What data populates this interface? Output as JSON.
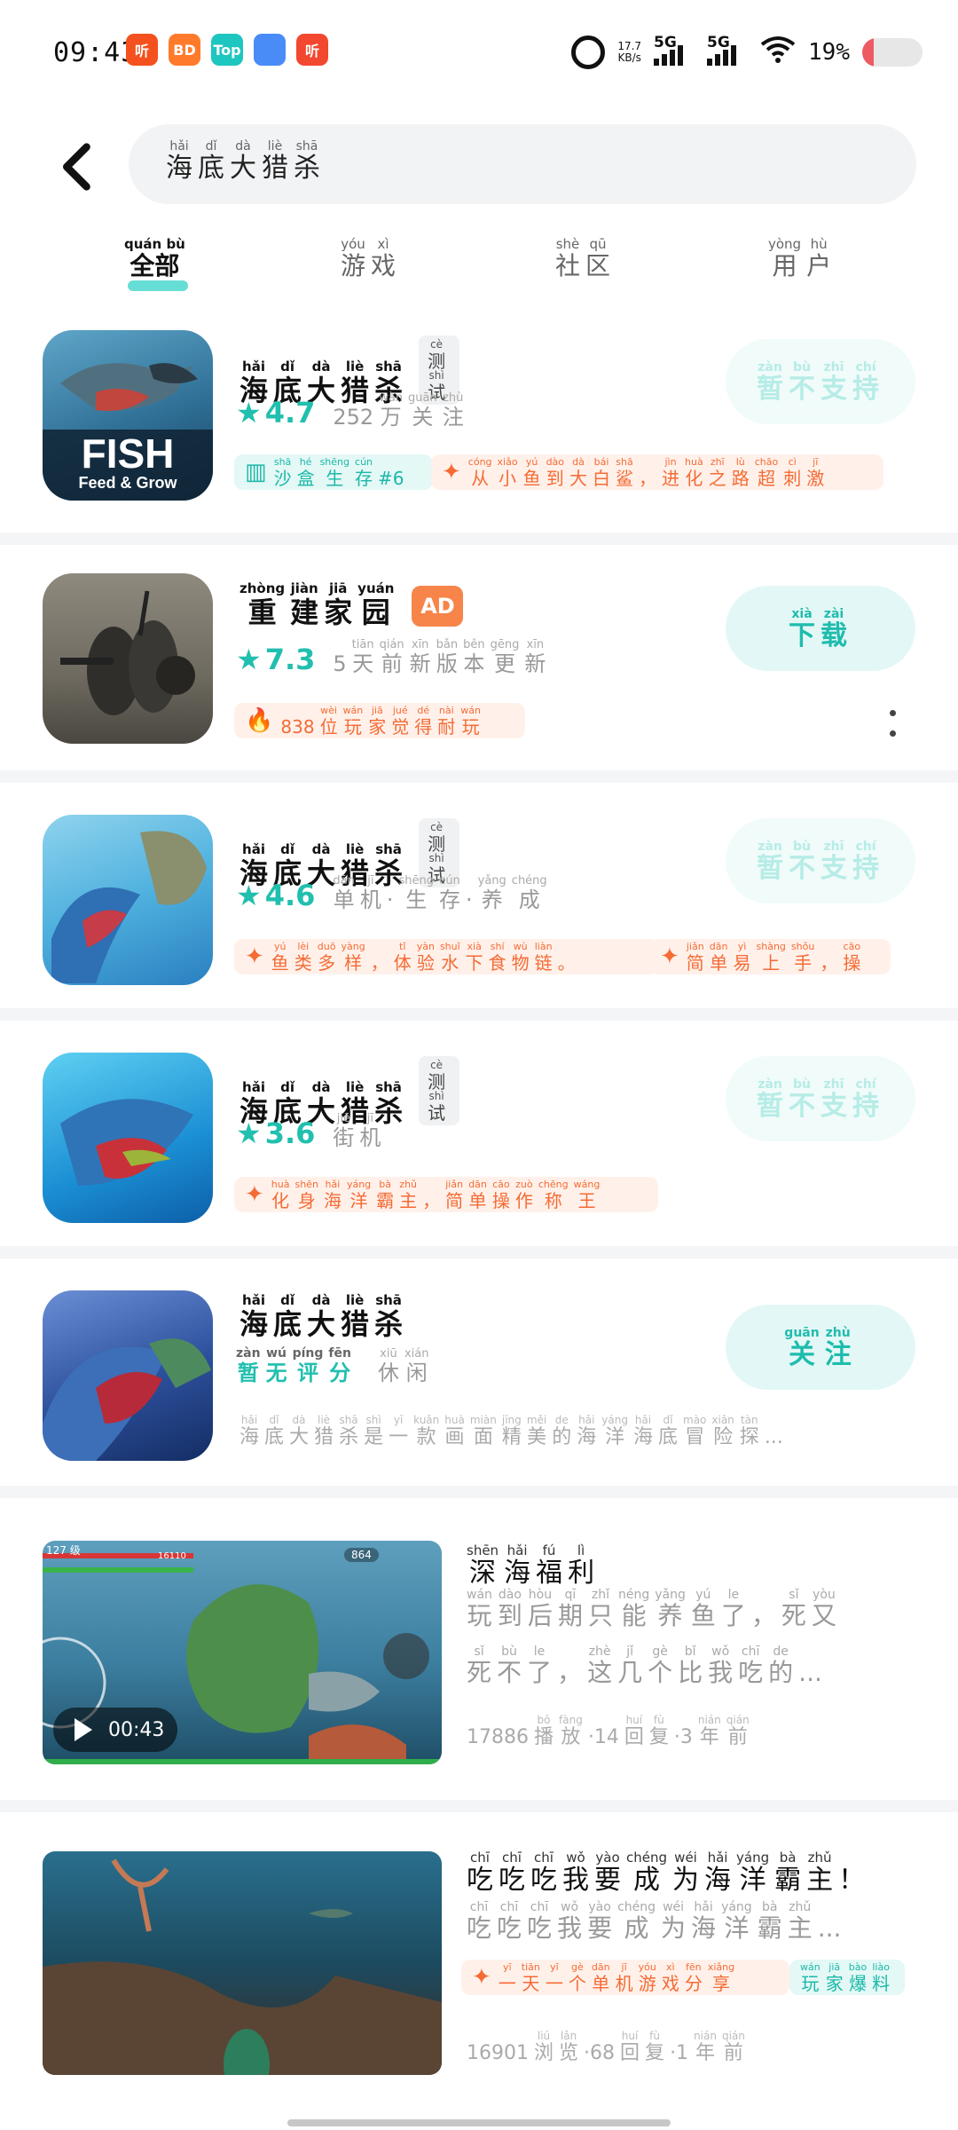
{
  "status_bar": {
    "time": "09:43",
    "app_icons": [
      {
        "name": "ting-app-icon",
        "text": "听",
        "color": "#f4511e"
      },
      {
        "name": "shop-app-icon",
        "text": "BD",
        "color": "#ff7a2b"
      },
      {
        "name": "top-app-icon",
        "text": "Top",
        "color": "#1ec6c0"
      },
      {
        "name": "blue-app-icon",
        "text": "",
        "color": "#4a8cf7"
      },
      {
        "name": "ting2-app-icon",
        "text": "听",
        "color": "#f2482f"
      }
    ],
    "net_speed": "17.7",
    "net_unit": "KB/s",
    "sig1_label": "5G",
    "sig2_label": "5G",
    "battery_pct": "19%",
    "battery_level": 0.19,
    "battery_color": "#ee5a63"
  },
  "search": {
    "query": [
      [
        "海",
        "hǎi"
      ],
      [
        "底",
        "dǐ"
      ],
      [
        "大",
        "dà"
      ],
      [
        "猎",
        "liè"
      ],
      [
        "杀",
        "shā"
      ]
    ]
  },
  "tabs": [
    {
      "label": [
        [
          "全部",
          "quán bù"
        ]
      ],
      "active": true
    },
    {
      "label": [
        [
          "游",
          "yóu"
        ],
        [
          "戏",
          "xì"
        ]
      ],
      "active": false
    },
    {
      "label": [
        [
          "社",
          "shè"
        ],
        [
          "区",
          "qū"
        ]
      ],
      "active": false
    },
    {
      "label": [
        [
          "用",
          "yòng"
        ],
        [
          "户",
          "hù"
        ]
      ],
      "active": false
    }
  ],
  "games": [
    {
      "title": [
        [
          "海",
          "hǎi"
        ],
        [
          "底",
          "dǐ"
        ],
        [
          "大",
          "dà"
        ],
        [
          "猎",
          "liè"
        ],
        [
          "杀",
          "shā"
        ]
      ],
      "badge_test": [
        [
          "测",
          "cè"
        ],
        [
          "试",
          "shì"
        ]
      ],
      "rating": "4.7",
      "meta": [
        [
          "252",
          ""
        ],
        [
          "万",
          "wàn"
        ],
        [
          "关",
          "guān"
        ],
        [
          "注",
          "zhù"
        ]
      ],
      "chip1_icon": "trophy-icon",
      "chip1": [
        [
          "沙",
          "shā"
        ],
        [
          "盒",
          "hé"
        ],
        [
          "生",
          "shēng"
        ],
        [
          "存",
          "cún"
        ],
        [
          "#6",
          ""
        ]
      ],
      "chip2": [
        [
          "从",
          "cóng"
        ],
        [
          "小",
          "xiǎo"
        ],
        [
          "鱼",
          "yú"
        ],
        [
          "到",
          "dào"
        ],
        [
          "大",
          "dà"
        ],
        [
          "白",
          "bái"
        ],
        [
          "鲨",
          "shā"
        ],
        [
          "，",
          ""
        ],
        [
          "进",
          "jìn"
        ],
        [
          "化",
          "huà"
        ],
        [
          "之",
          "zhī"
        ],
        [
          "路",
          "lù"
        ],
        [
          "超",
          "chāo"
        ],
        [
          "刺",
          "cì"
        ],
        [
          "激",
          "jī"
        ]
      ],
      "button": [
        [
          "暂",
          "zàn"
        ],
        [
          "不",
          "bù"
        ],
        [
          "支",
          "zhī"
        ],
        [
          "持",
          "chí"
        ]
      ],
      "button_state": "disabled",
      "thumb_text": "FISH",
      "thumb_sub": "Feed & Grow"
    },
    {
      "title": [
        [
          "重",
          "zhòng"
        ],
        [
          "建",
          "jiàn"
        ],
        [
          "家",
          "jiā"
        ],
        [
          "园",
          "yuán"
        ]
      ],
      "badge_ad": "AD",
      "rating": "7.3",
      "meta": [
        [
          "5",
          ""
        ],
        [
          "天",
          "tiān"
        ],
        [
          "前",
          "qián"
        ],
        [
          "新",
          "xīn"
        ],
        [
          "版",
          "bǎn"
        ],
        [
          "本",
          "běn"
        ],
        [
          "更",
          "gēng"
        ],
        [
          "新",
          "xīn"
        ]
      ],
      "chip_hot": [
        [
          "838",
          ""
        ],
        [
          "位",
          "wèi"
        ],
        [
          "玩",
          "wán"
        ],
        [
          "家",
          "jiā"
        ],
        [
          "觉",
          "jué"
        ],
        [
          "得",
          "dé"
        ],
        [
          "耐",
          "nài"
        ],
        [
          "玩",
          "wán"
        ]
      ],
      "button": [
        [
          "下",
          "xià"
        ],
        [
          "载",
          "zài"
        ]
      ],
      "button_state": "primary"
    },
    {
      "title": [
        [
          "海",
          "hǎi"
        ],
        [
          "底",
          "dǐ"
        ],
        [
          "大",
          "dà"
        ],
        [
          "猎",
          "liè"
        ],
        [
          "杀",
          "shā"
        ]
      ],
      "badge_test": [
        [
          "测",
          "cè"
        ],
        [
          "试",
          "shì"
        ]
      ],
      "rating": "4.6",
      "meta": [
        [
          "单",
          "dān"
        ],
        [
          "机",
          "jī"
        ],
        [
          "·",
          ""
        ],
        [
          "生",
          "shēng"
        ],
        [
          "存",
          "cún"
        ],
        [
          "·",
          ""
        ],
        [
          "养",
          "yǎng"
        ],
        [
          "成",
          "chéng"
        ]
      ],
      "chip1": [
        [
          "鱼",
          "yú"
        ],
        [
          "类",
          "lèi"
        ],
        [
          "多",
          "duō"
        ],
        [
          "样",
          "yàng"
        ],
        [
          "，",
          ""
        ],
        [
          "体",
          "tǐ"
        ],
        [
          "验",
          "yàn"
        ],
        [
          "水",
          "shuǐ"
        ],
        [
          "下",
          "xià"
        ],
        [
          "食",
          "shí"
        ],
        [
          "物",
          "wù"
        ],
        [
          "链",
          "liàn"
        ],
        [
          "。",
          ""
        ]
      ],
      "chip2": [
        [
          "简",
          "jiǎn"
        ],
        [
          "单",
          "dān"
        ],
        [
          "易",
          "yì"
        ],
        [
          "上",
          "shàng"
        ],
        [
          "手",
          "shǒu"
        ],
        [
          "，",
          ""
        ],
        [
          "操",
          "cāo"
        ]
      ],
      "button": [
        [
          "暂",
          "zàn"
        ],
        [
          "不",
          "bù"
        ],
        [
          "支",
          "zhī"
        ],
        [
          "持",
          "chí"
        ]
      ],
      "button_state": "disabled"
    },
    {
      "title": [
        [
          "海",
          "hǎi"
        ],
        [
          "底",
          "dǐ"
        ],
        [
          "大",
          "dà"
        ],
        [
          "猎",
          "liè"
        ],
        [
          "杀",
          "shā"
        ]
      ],
      "badge_test": [
        [
          "测",
          "cè"
        ],
        [
          "试",
          "shì"
        ]
      ],
      "rating": "3.6",
      "meta": [
        [
          "街",
          "jiē"
        ],
        [
          "机",
          "jī"
        ]
      ],
      "chip1": [
        [
          "化",
          "huà"
        ],
        [
          "身",
          "shēn"
        ],
        [
          "海",
          "hǎi"
        ],
        [
          "洋",
          "yáng"
        ],
        [
          "霸",
          "bà"
        ],
        [
          "主",
          "zhǔ"
        ],
        [
          "，",
          ""
        ],
        [
          "简",
          "jiǎn"
        ],
        [
          "单",
          "dān"
        ],
        [
          "操",
          "cāo"
        ],
        [
          "作",
          "zuò"
        ],
        [
          "称",
          "chēng"
        ],
        [
          "王",
          "wáng"
        ]
      ],
      "button": [
        [
          "暂",
          "zàn"
        ],
        [
          "不",
          "bù"
        ],
        [
          "支",
          "zhī"
        ],
        [
          "持",
          "chí"
        ]
      ],
      "button_state": "disabled"
    },
    {
      "title": [
        [
          "海",
          "hǎi"
        ],
        [
          "底",
          "dǐ"
        ],
        [
          "大",
          "dà"
        ],
        [
          "猎",
          "liè"
        ],
        [
          "杀",
          "shā"
        ]
      ],
      "no_rating": [
        [
          "暂",
          "zàn"
        ],
        [
          "无",
          "wú"
        ],
        [
          "评",
          "píng"
        ],
        [
          "分",
          "fēn"
        ]
      ],
      "meta": [
        [
          "休",
          "xiū"
        ],
        [
          "闲",
          "xián"
        ]
      ],
      "desc": [
        [
          "海",
          "hǎi"
        ],
        [
          "底",
          "dǐ"
        ],
        [
          "大",
          "dà"
        ],
        [
          "猎",
          "liè"
        ],
        [
          "杀",
          "shā"
        ],
        [
          "是",
          "shì"
        ],
        [
          "一",
          "yī"
        ],
        [
          "款",
          "kuǎn"
        ],
        [
          "画",
          "huà"
        ],
        [
          "面",
          "miàn"
        ],
        [
          "精",
          "jīng"
        ],
        [
          "美",
          "měi"
        ],
        [
          "的",
          "de"
        ],
        [
          "海",
          "hǎi"
        ],
        [
          "洋",
          "yáng"
        ],
        [
          "海",
          "hǎi"
        ],
        [
          "底",
          "dǐ"
        ],
        [
          "冒",
          "mào"
        ],
        [
          "险",
          "xiǎn"
        ],
        [
          "探",
          "tàn"
        ],
        [
          "...",
          ""
        ]
      ],
      "button": [
        [
          "关",
          "guān"
        ],
        [
          "注",
          "zhù"
        ]
      ],
      "button_state": "primary"
    }
  ],
  "posts": [
    {
      "title": [
        [
          "深",
          "shēn"
        ],
        [
          "海",
          "hǎi"
        ],
        [
          "福",
          "fú"
        ],
        [
          "利",
          "lì"
        ]
      ],
      "body1": [
        [
          "玩",
          "wán"
        ],
        [
          "到",
          "dào"
        ],
        [
          "后",
          "hòu"
        ],
        [
          "期",
          "qī"
        ],
        [
          "只",
          "zhǐ"
        ],
        [
          "能",
          "néng"
        ],
        [
          "养",
          "yǎng"
        ],
        [
          "鱼",
          "yú"
        ],
        [
          "了",
          "le"
        ],
        [
          "，",
          ""
        ],
        [
          "死",
          "sǐ"
        ],
        [
          "又",
          "yòu"
        ]
      ],
      "body2": [
        [
          "死",
          "sǐ"
        ],
        [
          "不",
          "bù"
        ],
        [
          "了",
          "le"
        ],
        [
          "，",
          ""
        ],
        [
          "这",
          "zhè"
        ],
        [
          "几",
          "jǐ"
        ],
        [
          "个",
          "gè"
        ],
        [
          "比",
          "bǐ"
        ],
        [
          "我",
          "wǒ"
        ],
        [
          "吃",
          "chī"
        ],
        [
          "的",
          "de"
        ],
        [
          "...",
          ""
        ]
      ],
      "meta": [
        [
          "17886",
          ""
        ],
        [
          "播",
          "bō"
        ],
        [
          "放",
          "fàng"
        ],
        [
          "·14",
          ""
        ],
        [
          "回",
          "huí"
        ],
        [
          "复",
          "fù"
        ],
        [
          "·3",
          ""
        ],
        [
          "年",
          "nián"
        ],
        [
          "前",
          "qián"
        ]
      ],
      "duration": "00:43",
      "level_label": "127 级",
      "hp": "16110",
      "coins": "864"
    },
    {
      "title": [
        [
          "吃",
          "chī"
        ],
        [
          "吃",
          "chī"
        ],
        [
          "吃",
          "chī"
        ],
        [
          "我",
          "wǒ"
        ],
        [
          "要",
          "yào"
        ],
        [
          "成",
          "chéng"
        ],
        [
          "为",
          "wéi"
        ],
        [
          "海",
          "hǎi"
        ],
        [
          "洋",
          "yáng"
        ],
        [
          "霸",
          "bà"
        ],
        [
          "主",
          "zhǔ"
        ],
        [
          "！",
          ""
        ]
      ],
      "body1": [
        [
          "吃",
          "chī"
        ],
        [
          "吃",
          "chī"
        ],
        [
          "吃",
          "chī"
        ],
        [
          "我",
          "wǒ"
        ],
        [
          "要",
          "yào"
        ],
        [
          "成",
          "chéng"
        ],
        [
          "为",
          "wéi"
        ],
        [
          "海",
          "hǎi"
        ],
        [
          "洋",
          "yáng"
        ],
        [
          "霸",
          "bà"
        ],
        [
          "主",
          "zhǔ"
        ],
        [
          "...",
          ""
        ]
      ],
      "chip1": [
        [
          "一",
          "yī"
        ],
        [
          "天",
          "tiān"
        ],
        [
          "一",
          "yī"
        ],
        [
          "个",
          "gè"
        ],
        [
          "单",
          "dān"
        ],
        [
          "机",
          "jī"
        ],
        [
          "游",
          "yóu"
        ],
        [
          "戏",
          "xì"
        ],
        [
          "分",
          "fēn"
        ],
        [
          "享",
          "xiǎng"
        ]
      ],
      "chip2": [
        [
          "玩",
          "wán"
        ],
        [
          "家",
          "jiā"
        ],
        [
          "爆",
          "bào"
        ],
        [
          "料",
          "liào"
        ]
      ],
      "meta": [
        [
          "16901",
          ""
        ],
        [
          "浏",
          "liú"
        ],
        [
          "览",
          "lǎn"
        ],
        [
          "·68",
          ""
        ],
        [
          "回",
          "huí"
        ],
        [
          "复",
          "fù"
        ],
        [
          "·1",
          ""
        ],
        [
          "年",
          "nián"
        ],
        [
          "前",
          "qián"
        ]
      ]
    }
  ]
}
